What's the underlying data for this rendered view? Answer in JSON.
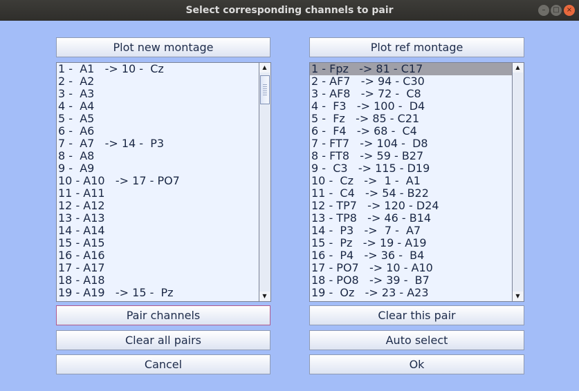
{
  "window": {
    "title": "Select corresponding channels to pair"
  },
  "left": {
    "plot_button": "Plot new montage",
    "channels": [
      "1 -  A1   -> 10 -  Cz",
      "2 -  A2",
      "3 -  A3",
      "4 -  A4",
      "5 -  A5",
      "6 -  A6",
      "7 -  A7   -> 14 -  P3",
      "8 -  A8",
      "9 -  A9",
      "10 - A10   -> 17 - PO7",
      "11 - A11",
      "12 - A12",
      "13 - A13",
      "14 - A14",
      "15 - A15",
      "16 - A16",
      "17 - A17",
      "18 - A18",
      "19 - A19   -> 15 -  Pz"
    ]
  },
  "right": {
    "plot_button": "Plot ref montage",
    "channels": [
      "1 - Fpz   -> 81 - C17",
      "2 - AF7   -> 94 - C30",
      "3 - AF8   -> 72 -  C8",
      "4 -  F3   -> 100 -  D4",
      "5 -  Fz   -> 85 - C21",
      "6 -  F4   -> 68 -  C4",
      "7 - FT7   -> 104 -  D8",
      "8 - FT8   -> 59 - B27",
      "9 -  C3   -> 115 - D19",
      "10 -  Cz   ->  1 -  A1",
      "11 -  C4   -> 54 - B22",
      "12 - TP7   -> 120 - D24",
      "13 - TP8   -> 46 - B14",
      "14 -  P3   ->  7 -  A7",
      "15 -  Pz   -> 19 - A19",
      "16 -  P4   -> 36 -  B4",
      "17 - PO7   -> 10 - A10",
      "18 - PO8   -> 39 -  B7",
      "19 -  Oz   -> 23 - A23"
    ],
    "selected_index": 0
  },
  "buttons": {
    "pair": "Pair channels",
    "clear_this": "Clear this pair",
    "clear_all": "Clear all pairs",
    "auto": "Auto select",
    "cancel": "Cancel",
    "ok": "Ok"
  }
}
